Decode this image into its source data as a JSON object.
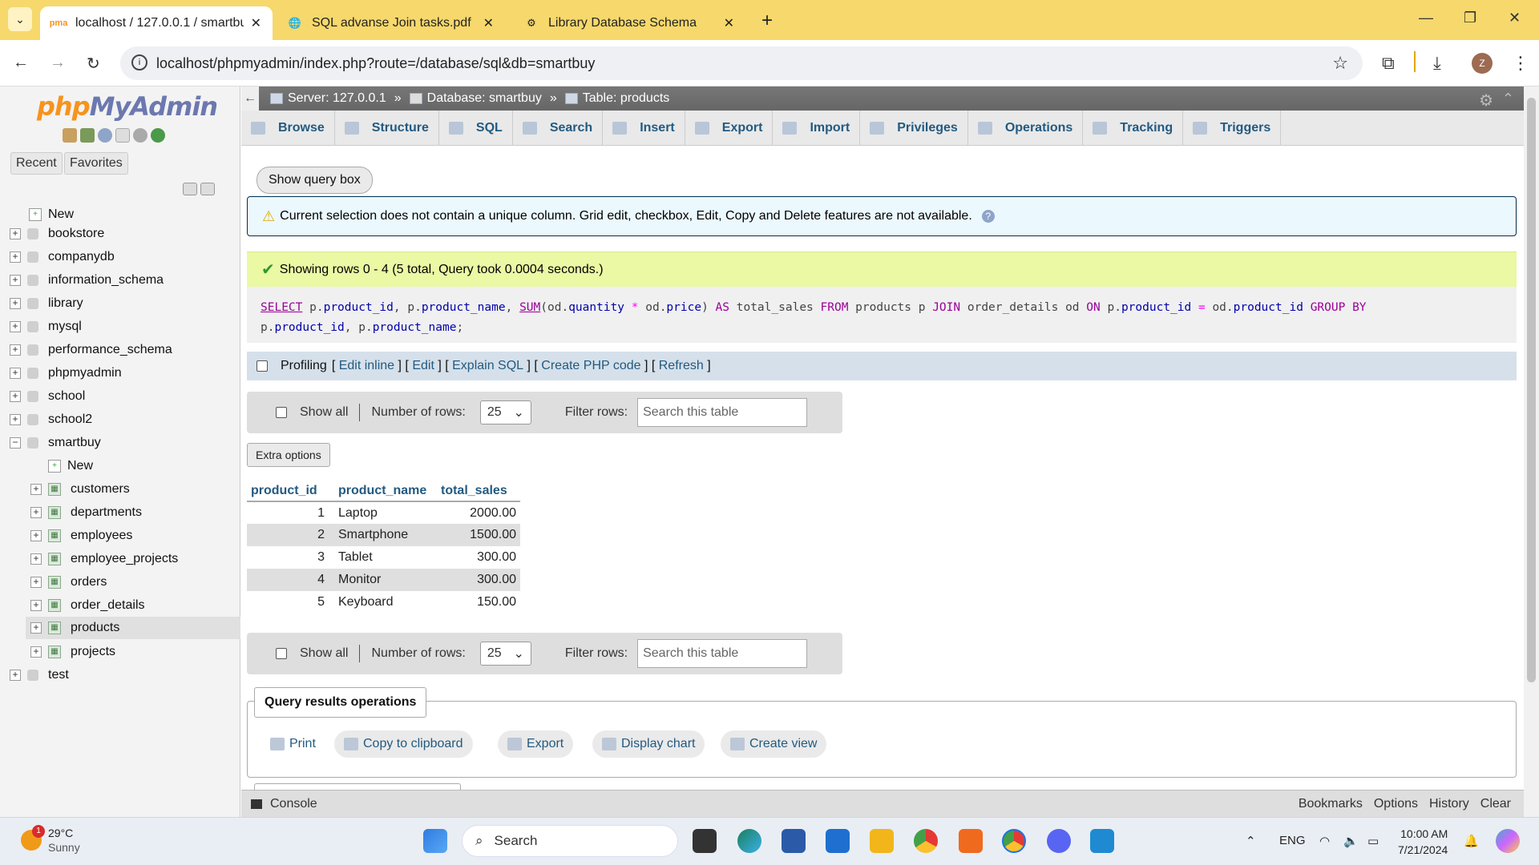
{
  "browser": {
    "tabs": [
      {
        "title": "localhost / 127.0.0.1 / smartbuy",
        "active": true,
        "icon": "phpmyadmin-favicon-icon"
      },
      {
        "title": "SQL advanse Join tasks.pdf",
        "active": false,
        "icon": "globe-icon"
      },
      {
        "title": "Library Database Schema",
        "active": false,
        "icon": "openai-icon"
      }
    ],
    "url": "localhost/phpmyadmin/index.php?route=/database/sql&db=smartbuy",
    "profile_initial": "Z"
  },
  "sidebar": {
    "logo_php": "php",
    "logo_myadmin": "MyAdmin",
    "recent_label": "Recent",
    "favorites_label": "Favorites",
    "tree": [
      {
        "label": "New",
        "kind": "new",
        "level": 0
      },
      {
        "label": "bookstore",
        "kind": "db",
        "level": 0
      },
      {
        "label": "companydb",
        "kind": "db",
        "level": 0
      },
      {
        "label": "information_schema",
        "kind": "db",
        "level": 0
      },
      {
        "label": "library",
        "kind": "db",
        "level": 0
      },
      {
        "label": "mysql",
        "kind": "db",
        "level": 0
      },
      {
        "label": "performance_schema",
        "kind": "db",
        "level": 0
      },
      {
        "label": "phpmyadmin",
        "kind": "db",
        "level": 0
      },
      {
        "label": "school",
        "kind": "db",
        "level": 0
      },
      {
        "label": "school2",
        "kind": "db",
        "level": 0
      },
      {
        "label": "smartbuy",
        "kind": "db-open",
        "level": 0
      },
      {
        "label": "New",
        "kind": "new",
        "level": 1
      },
      {
        "label": "customers",
        "kind": "table",
        "level": 1
      },
      {
        "label": "departments",
        "kind": "table",
        "level": 1
      },
      {
        "label": "employees",
        "kind": "table",
        "level": 1
      },
      {
        "label": "employee_projects",
        "kind": "table",
        "level": 1
      },
      {
        "label": "orders",
        "kind": "table",
        "level": 1
      },
      {
        "label": "order_details",
        "kind": "table",
        "level": 1
      },
      {
        "label": "products",
        "kind": "table",
        "level": 1,
        "selected": true
      },
      {
        "label": "projects",
        "kind": "table",
        "level": 1
      },
      {
        "label": "test",
        "kind": "db",
        "level": 0
      }
    ]
  },
  "breadcrumb": {
    "server": "Server: 127.0.0.1",
    "database": "Database: smartbuy",
    "table": "Table: products"
  },
  "menu_tabs": [
    "Browse",
    "Structure",
    "SQL",
    "Search",
    "Insert",
    "Export",
    "Import",
    "Privileges",
    "Operations",
    "Tracking",
    "Triggers"
  ],
  "show_query_box": "Show query box",
  "warning_text": "Current selection does not contain a unique column. Grid edit, checkbox, Edit, Copy and Delete features are not available.",
  "success_text": "Showing rows 0 - 4 (5 total, Query took 0.0004 seconds.)",
  "profiling": {
    "label": "Profiling",
    "links": [
      "Edit inline",
      "Edit",
      "Explain SQL",
      "Create PHP code",
      "Refresh"
    ]
  },
  "navbar": {
    "show_all": "Show all",
    "rows_label": "Number of rows:",
    "rows_value": "25",
    "filter_label": "Filter rows:",
    "filter_placeholder": "Search this table"
  },
  "extra_options": "Extra options",
  "results": {
    "columns": [
      "product_id",
      "product_name",
      "total_sales"
    ],
    "rows": [
      [
        "1",
        "Laptop",
        "2000.00"
      ],
      [
        "2",
        "Smartphone",
        "1500.00"
      ],
      [
        "3",
        "Tablet",
        "300.00"
      ],
      [
        "4",
        "Monitor",
        "300.00"
      ],
      [
        "5",
        "Keyboard",
        "150.00"
      ]
    ]
  },
  "query_ops": {
    "title": "Query results operations",
    "buttons": [
      "Print",
      "Copy to clipboard",
      "Export",
      "Display chart",
      "Create view"
    ]
  },
  "console": {
    "label": "Console",
    "links": [
      "Bookmarks",
      "Options",
      "History",
      "Clear"
    ]
  },
  "taskbar": {
    "temp": "29°C",
    "weather": "Sunny",
    "weather_badge": "1",
    "search_label": "Search",
    "lang": "ENG",
    "time": "10:00 AM",
    "date": "7/21/2024"
  }
}
